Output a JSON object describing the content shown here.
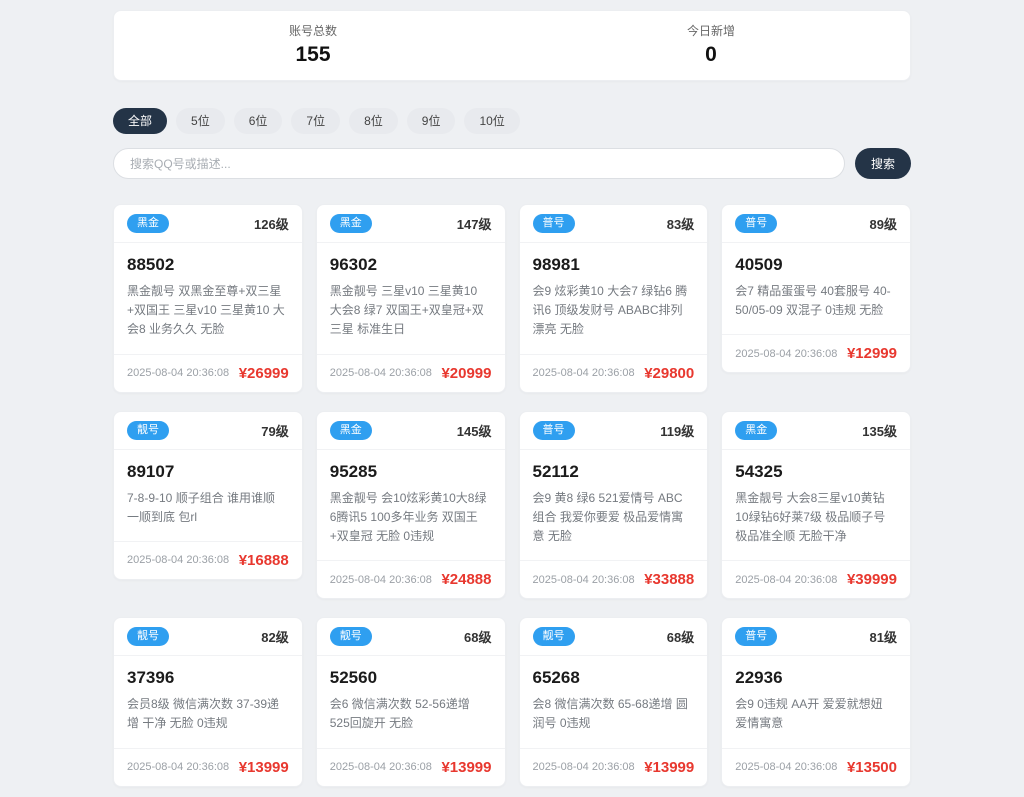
{
  "stats": {
    "total_label": "账号总数",
    "total_value": "155",
    "today_label": "今日新增",
    "today_value": "0"
  },
  "filters": [
    {
      "label": "全部",
      "active": true
    },
    {
      "label": "5位",
      "active": false
    },
    {
      "label": "6位",
      "active": false
    },
    {
      "label": "7位",
      "active": false
    },
    {
      "label": "8位",
      "active": false
    },
    {
      "label": "9位",
      "active": false
    },
    {
      "label": "10位",
      "active": false
    }
  ],
  "search": {
    "placeholder": "搜索QQ号或描述...",
    "button_label": "搜索"
  },
  "colors": {
    "badge_blue": "#2f9ff0",
    "price_red": "#e8382f",
    "dark_navy": "#243447",
    "page_background": "#eef0f3"
  },
  "cards": [
    {
      "badge": "黑金",
      "level": "126级",
      "number": "88502",
      "desc": "黑金靓号 双黑金至尊+双三星+双国王 三星v10 三星黄10 大会8 业务久久 无脸",
      "date": "2025-08-04 20:36:08",
      "price": "¥26999"
    },
    {
      "badge": "黑金",
      "level": "147级",
      "number": "96302",
      "desc": "黑金靓号 三星v10 三星黄10 大会8 绿7 双国王+双皇冠+双三星 标准生日",
      "date": "2025-08-04 20:36:08",
      "price": "¥20999"
    },
    {
      "badge": "普号",
      "level": "83级",
      "number": "98981",
      "desc": "会9 炫彩黄10 大会7 绿钻6 腾讯6 顶级发财号 ABABC排列漂亮 无脸",
      "date": "2025-08-04 20:36:08",
      "price": "¥29800"
    },
    {
      "badge": "普号",
      "level": "89级",
      "number": "40509",
      "desc": "会7 精品蛋蛋号 40套服号 40-50/05-09 双混子 0违规 无脸",
      "date": "2025-08-04 20:36:08",
      "price": "¥12999"
    },
    {
      "badge": "靓号",
      "level": "79级",
      "number": "89107",
      "desc": "7-8-9-10 顺子组合 谁用谁顺 一顺到底 包rl",
      "date": "2025-08-04 20:36:08",
      "price": "¥16888"
    },
    {
      "badge": "黑金",
      "level": "145级",
      "number": "95285",
      "desc": "黑金靓号 会10炫彩黄10大8绿6腾讯5 100多年业务 双国王+双皇冠 无脸 0违规",
      "date": "2025-08-04 20:36:08",
      "price": "¥24888"
    },
    {
      "badge": "普号",
      "level": "119级",
      "number": "52112",
      "desc": "会9 黄8 绿6 521爱情号 ABC组合 我爱你要爱 极品爱情寓意 无脸",
      "date": "2025-08-04 20:36:08",
      "price": "¥33888"
    },
    {
      "badge": "黑金",
      "level": "135级",
      "number": "54325",
      "desc": "黑金靓号 大会8三星v10黄钻10绿钻6好莱7级 极品顺子号 极品准全顺 无脸干净",
      "date": "2025-08-04 20:36:08",
      "price": "¥39999"
    },
    {
      "badge": "靓号",
      "level": "82级",
      "number": "37396",
      "desc": "会员8级 微信满次数 37-39递增 干净 无脸 0违规",
      "date": "2025-08-04 20:36:08",
      "price": "¥13999"
    },
    {
      "badge": "靓号",
      "level": "68级",
      "number": "52560",
      "desc": "会6 微信满次数 52-56递增 525回旋开 无脸",
      "date": "2025-08-04 20:36:08",
      "price": "¥13999"
    },
    {
      "badge": "靓号",
      "level": "68级",
      "number": "65268",
      "desc": "会8 微信满次数 65-68递增 圆润号 0违规",
      "date": "2025-08-04 20:36:08",
      "price": "¥13999"
    },
    {
      "badge": "普号",
      "level": "81级",
      "number": "22936",
      "desc": "会9 0违规 AA开 爱爱就想妞 爱情寓意",
      "date": "2025-08-04 20:36:08",
      "price": "¥13500"
    }
  ]
}
